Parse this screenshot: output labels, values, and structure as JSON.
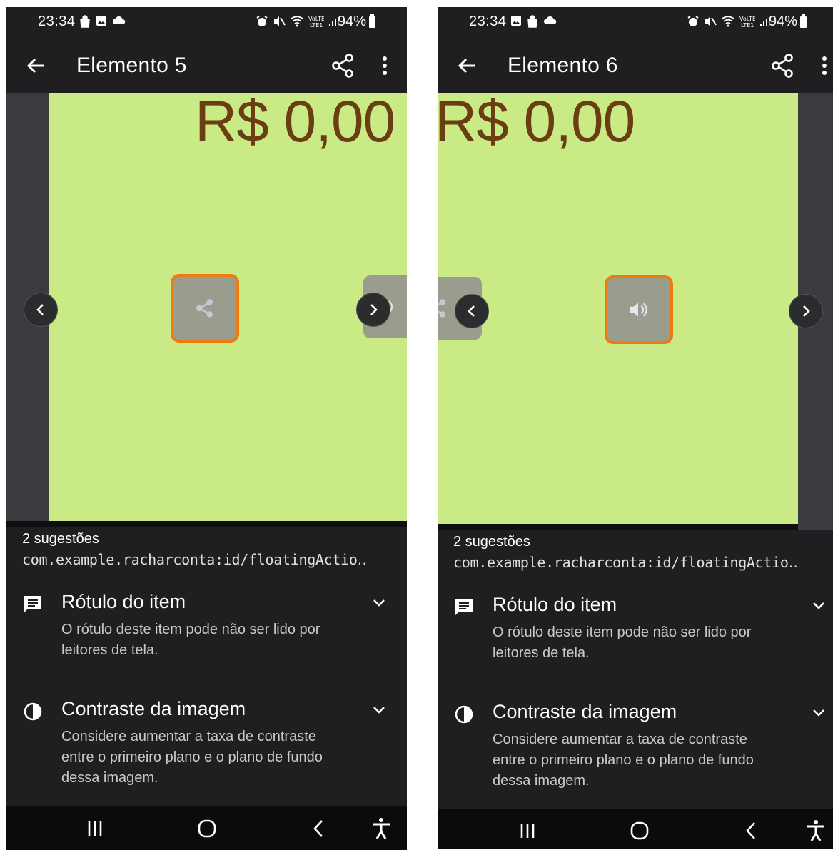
{
  "screens": [
    {
      "status": {
        "time": "23:34",
        "battery": "94%"
      },
      "app_bar": {
        "title": "Elemento 5"
      },
      "preview": {
        "price_text": "R$ 0,00"
      },
      "suggestions": {
        "count_label": "2 sugestões",
        "resource_id": "com.example.racharconta:id/floatingActio‥",
        "items": [
          {
            "title": "Rótulo do item",
            "description": "O rótulo deste item pode não ser lido por leitores de tela."
          },
          {
            "title": "Contraste da imagem",
            "description": "Considere aumentar a taxa de contraste entre o primeiro plano e o plano de fundo dessa imagem."
          }
        ]
      }
    },
    {
      "status": {
        "time": "23:34",
        "battery": "94%"
      },
      "app_bar": {
        "title": "Elemento 6"
      },
      "preview": {
        "price_text": "R$ 0,00"
      },
      "suggestions": {
        "count_label": "2 sugestões",
        "resource_id": "com.example.racharconta:id/floatingActio‥",
        "items": [
          {
            "title": "Rótulo do item",
            "description": "O rótulo deste item pode não ser lido por leitores de tela."
          },
          {
            "title": "Contraste da imagem",
            "description": "Considere aumentar a taxa de contraste entre o primeiro plano e o plano de fundo dessa imagem."
          }
        ]
      }
    }
  ],
  "colors": {
    "app_background": "#1f1f22",
    "preview_green": "#c9ea85",
    "price_brown": "#6b3d12",
    "highlight_orange": "#ee7a12"
  },
  "icons": [
    "back-arrow-icon",
    "share-icon",
    "more-vert-icon",
    "chevron-left-icon",
    "chevron-right-icon",
    "volume-icon",
    "comment-icon",
    "contrast-icon",
    "chevron-down-icon",
    "recents-icon",
    "home-icon",
    "back-icon",
    "accessibility-icon"
  ]
}
